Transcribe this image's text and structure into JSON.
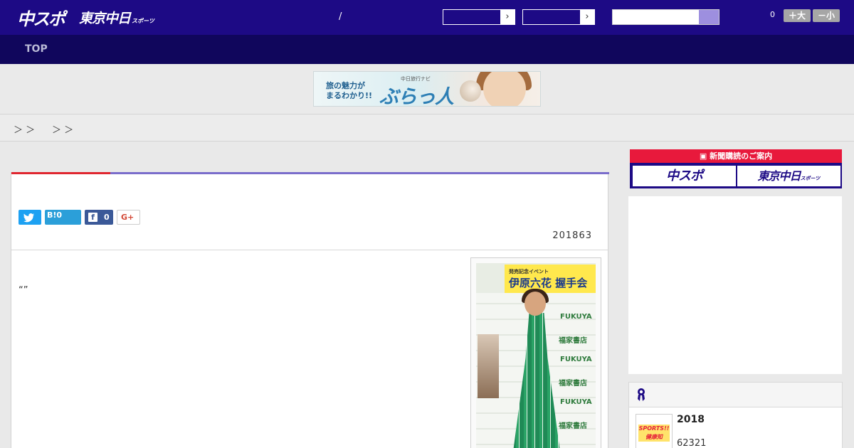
{
  "header": {
    "logo_chuspo": "中スポ",
    "logo_tokyo": "東京中日",
    "logo_tokyo_suffix": "スポーツ",
    "separator": "/",
    "select_1": "",
    "select_2": "",
    "search": {
      "placeholder": ""
    },
    "font_size_count": "0",
    "font_larger_label": "＋大",
    "font_smaller_label": "－小"
  },
  "nav": {
    "items": [
      {
        "label": "TOP"
      }
    ]
  },
  "banner": {
    "line1": "旅の魅力が",
    "line2": "まるわかり!!",
    "sub": "中日旅行ナビ",
    "brand": "ぶらっ人"
  },
  "breadcrumb": {
    "items": [
      "＞ ＞",
      "＞ ＞"
    ]
  },
  "article": {
    "share": {
      "twitter_icon": "twitter-icon",
      "hatena_label": "B!0",
      "facebook_count": "0",
      "gplus_label": "G+"
    },
    "date": "201863",
    "body": "“”",
    "photo": {
      "sign_title": "伊原六花 握手会",
      "sign_sub": "発売記念イベント",
      "store_logo": "FUKUYA",
      "store_name": "福家書店"
    }
  },
  "sidebar": {
    "subscribe": {
      "header": "新聞購読のご案内",
      "chuspo": "中スポ",
      "tokyo": "東京中日",
      "tokyo_suffix": "スポーツ"
    },
    "ranking": {
      "icon": "medal-icon",
      "items": [
        {
          "title": "2018",
          "subtitle": "62321",
          "thumb_text": "SPORTS!! 健康知"
        }
      ]
    }
  },
  "colors": {
    "header_bg": "#1d0a85",
    "nav_bg": "#10065c",
    "accent_red": "#e0262f",
    "accent_purple": "#7a6dcb",
    "subscribe_red": "#e8193c"
  }
}
